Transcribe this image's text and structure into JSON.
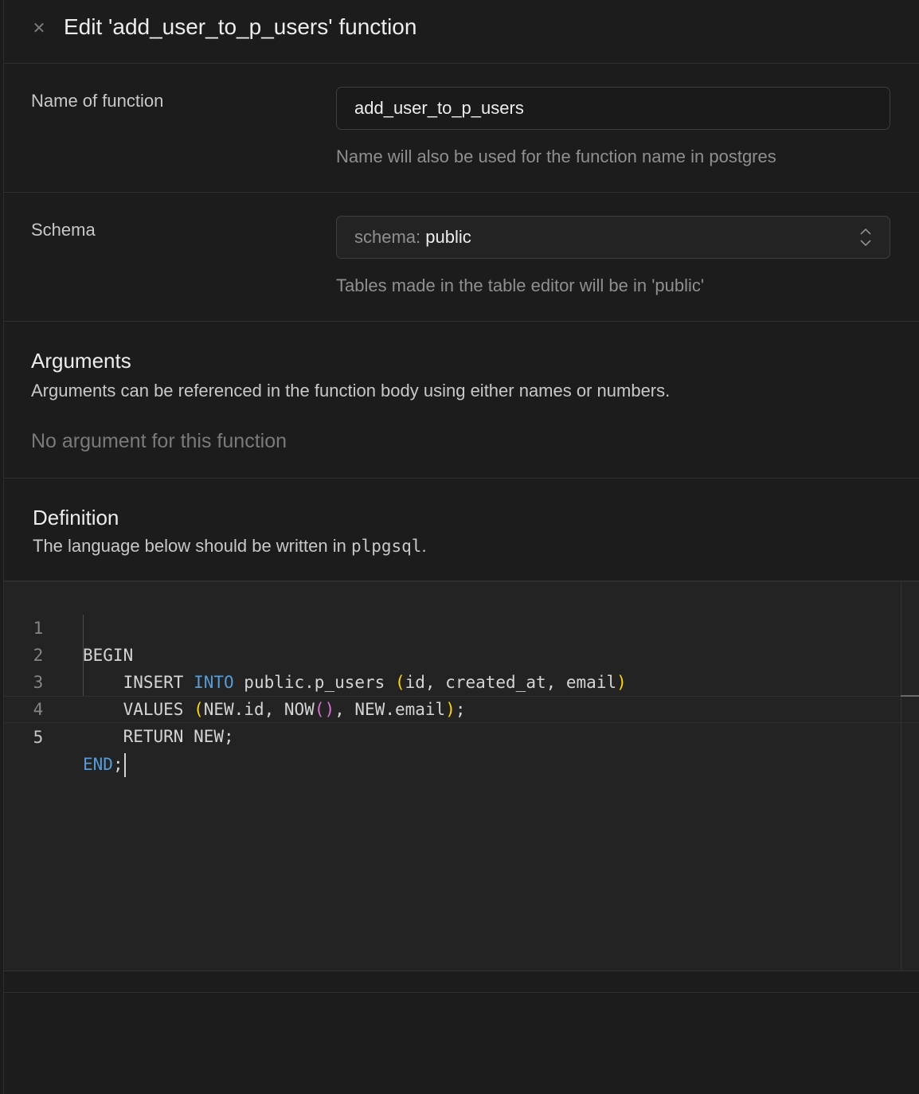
{
  "header": {
    "title": "Edit 'add_user_to_p_users' function",
    "close_icon": "close-icon"
  },
  "name_field": {
    "label": "Name of function",
    "value": "add_user_to_p_users",
    "helper": "Name will also be used for the function name in postgres"
  },
  "schema_field": {
    "label": "Schema",
    "prefix": "schema:",
    "value": "public",
    "helper": "Tables made in the table editor will be in 'public'"
  },
  "arguments": {
    "title": "Arguments",
    "description": "Arguments can be referenced in the function body using either names or numbers.",
    "empty": "No argument for this function"
  },
  "definition": {
    "title": "Definition",
    "description_prefix": "The language below should be written in",
    "language": "plpgsql",
    "description_suffix": "."
  },
  "editor": {
    "line_numbers": [
      "1",
      "2",
      "3",
      "4",
      "5"
    ],
    "lines": [
      "BEGIN",
      "    INSERT INTO public.p_users (id, created_at, email)",
      "    VALUES (NEW.id, NOW(), NEW.email);",
      "    RETURN NEW;",
      "END;"
    ],
    "active_line": 5,
    "colors": {
      "keyword": "#569cd6",
      "paren_outer": "#ffd700",
      "paren_inner": "#da70d6"
    }
  }
}
